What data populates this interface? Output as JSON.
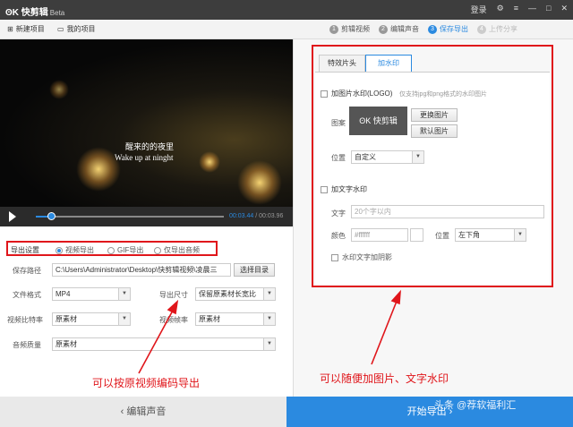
{
  "app": {
    "logo_mark": "ʘK",
    "name": "快剪辑",
    "badge": "Beta"
  },
  "window": {
    "login": "登录",
    "icons": [
      "gear-icon",
      "menu-icon",
      "minimize-icon",
      "maximize-icon",
      "close-icon"
    ]
  },
  "toolbar": {
    "new_project": "新建项目",
    "my_projects": "我的项目"
  },
  "steps": [
    {
      "num": "1",
      "label": "剪辑视频"
    },
    {
      "num": "2",
      "label": "编辑声音"
    },
    {
      "num": "3",
      "label": "保存导出"
    },
    {
      "num": "4",
      "label": "上传分享"
    }
  ],
  "video": {
    "subtitle_cn": "醒来的的夜里",
    "subtitle_en": "Wake up at ninght"
  },
  "player": {
    "progress": 0.08,
    "time_current": "00:03.44",
    "time_total": "00:03.96"
  },
  "export": {
    "label": "导出设置",
    "options": [
      "视频导出",
      "GIF导出",
      "仅导出音频"
    ],
    "save_path_label": "保存路径",
    "save_path_value": "C:\\Users\\Administrator\\Desktop\\快剪辑视频\\凌晨三",
    "choose_dir": "选择目录",
    "format_label": "文件格式",
    "format_value": "MP4",
    "size_label": "导出尺寸",
    "size_value": "保留原素材长宽比",
    "bitrate_label": "视频比特率",
    "bitrate_value": "原素材",
    "fps_label": "视频帧率",
    "fps_value": "原素材",
    "audio_label": "音频质量",
    "audio_value": "原素材"
  },
  "annotations": {
    "left": "可以按原视频编码导出",
    "right": "可以随便加图片、文字水印"
  },
  "tabs": [
    "特效片头",
    "加水印"
  ],
  "watermark_panel": {
    "add_image": "加图片水印(LOGO)",
    "image_hint": "仅支持jpg和png格式的水印图片",
    "icon_label": "图案",
    "preview_logo": "ʘK 快剪辑",
    "replace_image": "更换图片",
    "default_image": "默认图片",
    "position_label": "位置",
    "position_value": "自定义",
    "add_text": "加文字水印",
    "text_label": "文字",
    "text_placeholder": "20个字以内",
    "color_label": "颜色",
    "color_value": "#ffffff",
    "text_position_label": "位置",
    "text_position_value": "左下角",
    "shadow_label": "水印文字加阴影"
  },
  "footer": {
    "back": "‹ 编辑声音",
    "start": "开始导出 ›"
  },
  "overlay": {
    "watermark": "头条 @荐软福利汇"
  },
  "colors": {
    "accent": "#2b8ae0",
    "annotation": "#e0161b"
  }
}
